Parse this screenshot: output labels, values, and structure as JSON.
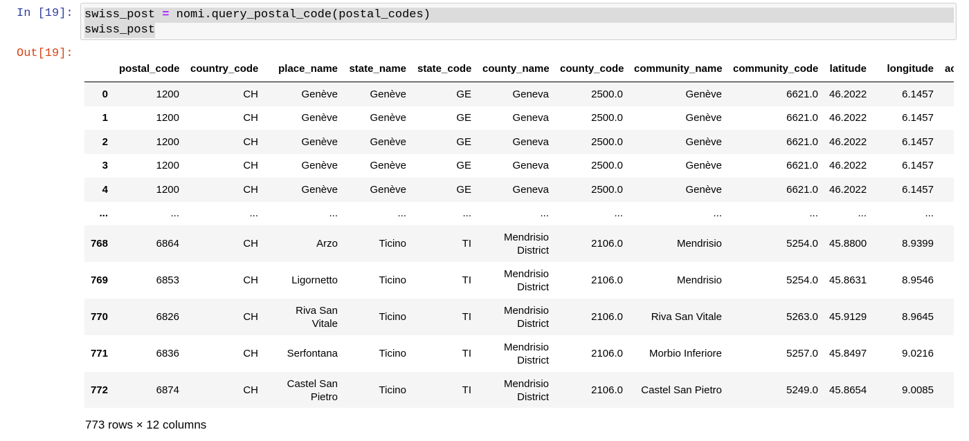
{
  "cell": {
    "in_prompt": "In [19]:",
    "out_prompt": "Out[19]:",
    "code_line1_var": "swiss_post",
    "code_line1_op": "=",
    "code_line1_call": "nomi.query_postal_code(postal_codes)",
    "code_line2": "swiss_post"
  },
  "table": {
    "columns": [
      "",
      "postal_code",
      "country_code",
      "place_name",
      "state_name",
      "state_code",
      "county_name",
      "county_code",
      "community_name",
      "community_code",
      "latitude",
      "longitude",
      "accu"
    ],
    "rows": [
      [
        "0",
        "1200",
        "CH",
        "Genève",
        "Genève",
        "GE",
        "Geneva",
        "2500.0",
        "Genève",
        "6621.0",
        "46.2022",
        "6.1457",
        ""
      ],
      [
        "1",
        "1200",
        "CH",
        "Genève",
        "Genève",
        "GE",
        "Geneva",
        "2500.0",
        "Genève",
        "6621.0",
        "46.2022",
        "6.1457",
        ""
      ],
      [
        "2",
        "1200",
        "CH",
        "Genève",
        "Genève",
        "GE",
        "Geneva",
        "2500.0",
        "Genève",
        "6621.0",
        "46.2022",
        "6.1457",
        ""
      ],
      [
        "3",
        "1200",
        "CH",
        "Genève",
        "Genève",
        "GE",
        "Geneva",
        "2500.0",
        "Genève",
        "6621.0",
        "46.2022",
        "6.1457",
        ""
      ],
      [
        "4",
        "1200",
        "CH",
        "Genève",
        "Genève",
        "GE",
        "Geneva",
        "2500.0",
        "Genève",
        "6621.0",
        "46.2022",
        "6.1457",
        ""
      ],
      [
        "...",
        "...",
        "...",
        "...",
        "...",
        "...",
        "...",
        "...",
        "...",
        "...",
        "...",
        "...",
        ""
      ],
      [
        "768",
        "6864",
        "CH",
        "Arzo",
        "Ticino",
        "TI",
        "Mendrisio District",
        "2106.0",
        "Mendrisio",
        "5254.0",
        "45.8800",
        "8.9399",
        ""
      ],
      [
        "769",
        "6853",
        "CH",
        "Ligornetto",
        "Ticino",
        "TI",
        "Mendrisio District",
        "2106.0",
        "Mendrisio",
        "5254.0",
        "45.8631",
        "8.9546",
        ""
      ],
      [
        "770",
        "6826",
        "CH",
        "Riva San Vitale",
        "Ticino",
        "TI",
        "Mendrisio District",
        "2106.0",
        "Riva San Vitale",
        "5263.0",
        "45.9129",
        "8.9645",
        ""
      ],
      [
        "771",
        "6836",
        "CH",
        "Serfontana",
        "Ticino",
        "TI",
        "Mendrisio District",
        "2106.0",
        "Morbio Inferiore",
        "5257.0",
        "45.8497",
        "9.0216",
        ""
      ],
      [
        "772",
        "6874",
        "CH",
        "Castel San Pietro",
        "Ticino",
        "TI",
        "Mendrisio District",
        "2106.0",
        "Castel San Pietro",
        "5249.0",
        "45.8654",
        "9.0085",
        ""
      ]
    ],
    "summary": "773 rows × 12 columns"
  }
}
